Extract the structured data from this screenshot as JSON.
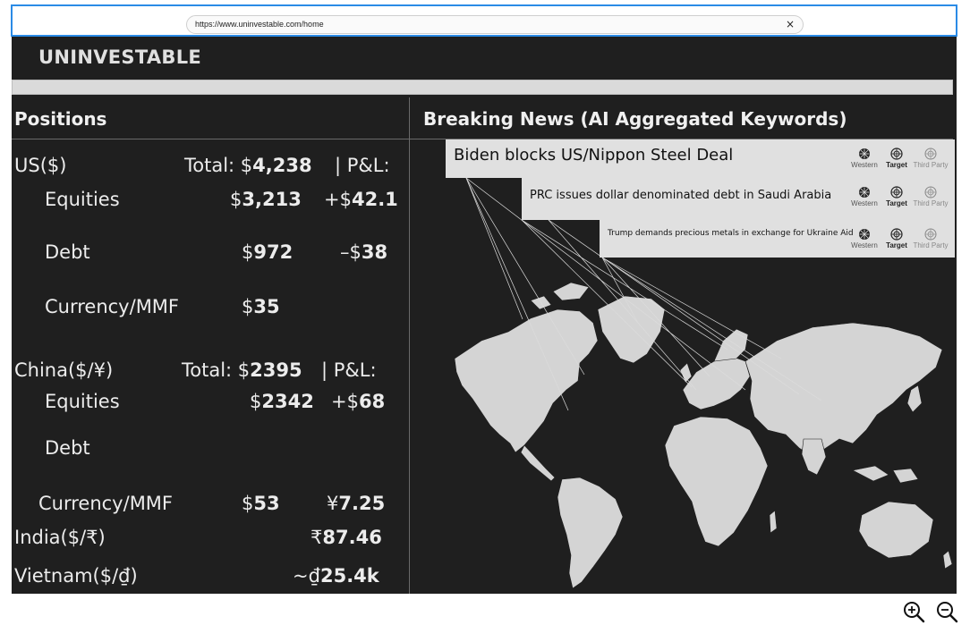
{
  "browser": {
    "url": "https://www.uninvestable.com/home",
    "close_glyph": "×"
  },
  "app": {
    "title": "UNINVESTABLE"
  },
  "positions": {
    "heading": "Positions",
    "us": {
      "label": "US($)",
      "total_label": "Total: $",
      "total_value": "4,238",
      "pnl_label": "| P&L:",
      "equities": {
        "label": "Equities",
        "currency": "$",
        "amount": "3,213",
        "pnl_prefix": "+$",
        "pnl": "42.1"
      },
      "debt": {
        "label": "Debt",
        "currency": "$",
        "amount": "972",
        "pnl_prefix": "–$",
        "pnl": "38"
      },
      "mmf": {
        "label": "Currency/MMF",
        "currency": "$",
        "amount": "35"
      }
    },
    "china": {
      "label": "China($/¥)",
      "total_label": "Total: $",
      "total_value": "2395",
      "pnl_label": "| P&L:",
      "equities": {
        "label": "Equities",
        "currency": "$",
        "amount": "2342",
        "pnl_prefix": "+$",
        "pnl": "68"
      },
      "debt": {
        "label": "Debt"
      },
      "mmf": {
        "label": "Currency/MMF",
        "currency": "$",
        "amount": "53",
        "fx_prefix": "¥",
        "fx": "7.25"
      }
    },
    "india": {
      "label": "India($/₹)",
      "fx_prefix": "₹",
      "fx": "87.46"
    },
    "vietnam": {
      "label": "Vietnam($/₫)",
      "fx_prefix": "~₫",
      "fx": "25.4k"
    }
  },
  "news": {
    "heading": "Breaking News (AI Aggregated Keywords)",
    "tags": [
      "Western",
      "Target",
      "Third Party"
    ],
    "items": [
      {
        "headline": "Biden blocks US/Nippon Steel Deal"
      },
      {
        "headline": "PRC issues dollar denominated debt in Saudi Arabia"
      },
      {
        "headline": "Trump demands precious metals in exchange for Ukraine Aid"
      }
    ]
  },
  "colors": {
    "panel_bg": "#1f1f1f",
    "card_bg": "#e0e0e0",
    "land": "#d4d4d4",
    "accent_frame": "#2b8be6"
  },
  "icons": [
    "close-icon",
    "zoom-in-icon",
    "zoom-out-icon",
    "western-tag-icon",
    "target-tag-icon",
    "third-party-tag-icon",
    "world-map"
  ]
}
